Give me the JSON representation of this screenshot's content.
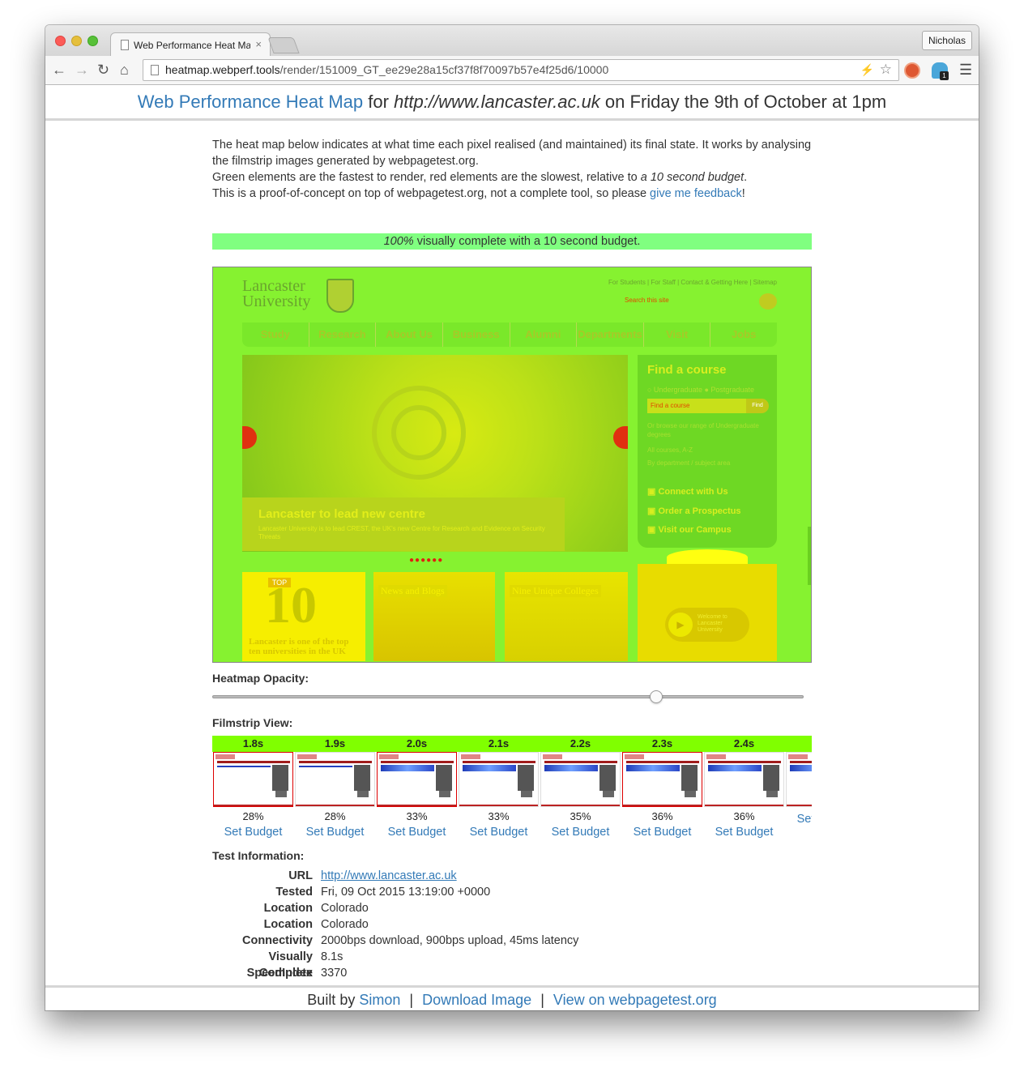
{
  "browser": {
    "tab_title": "Web Performance Heat Map",
    "tab_close": "×",
    "profile_name": "Nicholas",
    "url_host": "heatmap.webperf.tools",
    "url_path": "/render/151009_GT_ee29e28a15cf37f8f70097b57e4f25d6/10000",
    "icons": [
      "back-icon",
      "forward-icon",
      "reload-icon",
      "home-icon",
      "page-icon",
      "lightning-icon",
      "star-icon",
      "duckduckgo-icon",
      "ghostery-icon",
      "menu-icon"
    ],
    "ext_badge": "1"
  },
  "header": {
    "title_link": "Web Performance Heat Map",
    "for_text": " for ",
    "site": "http://www.lancaster.ac.uk",
    "date_text": " on Friday the 9th of October at 1pm"
  },
  "intro": {
    "line1": "The heat map below indicates at what time each pixel realised (and maintained) its final state. It works by analysing the filmstrip images generated by webpagetest.org.",
    "line2_a": "Green elements are the fastest to render, red elements are the slowest, relative to ",
    "line2_em": "a 10 second budget",
    "line2_b": ".",
    "line3_a": "This is a proof-of-concept on top of webpagetest.org, not a complete tool, so please ",
    "line3_link": "give me feedback",
    "line3_b": "!"
  },
  "complete": {
    "pct": "100%",
    "text": " visually complete with a 10 second budget."
  },
  "heatmap": {
    "logo": "Lancaster University",
    "toplinks": "For Students | For Staff | Contact & Getting Here | Sitemap",
    "search": "Search this site",
    "nav": [
      "Study",
      "Research",
      "About Us",
      "Business",
      "Alumni",
      "Departments",
      "Visit",
      "Jobs"
    ],
    "caption_title": "Lancaster to lead new centre",
    "caption_body": "Lancaster University is to lead CREST, the UK's new Centre for Research and Evidence on Security Threats",
    "dots": "●●●●●●",
    "course_title": "Find a course",
    "course_radio": "○ Undergraduate   ● Postgraduate",
    "course_input": "Find a course",
    "course_find": "Find",
    "course_txt": "Or browse our range of Undergraduate degrees",
    "course_txt2": "All courses, A-Z",
    "course_txt3": "By department / subject area",
    "link1": "Connect with Us",
    "link2": "Order a Prospectus",
    "link3": "Visit our Campus",
    "tile1_badge": "TOP",
    "tile1_big": "10",
    "tile1_txt": "Lancaster is one of the top ten universities in the UK",
    "tile2_lbl": "News and Blogs",
    "tile3_lbl": "Nine Unique Colleges",
    "video_txt": "Welcome to Lancaster University",
    "play": "▶"
  },
  "opacity": {
    "label": "Heatmap Opacity:",
    "value": 0.75
  },
  "filmstrip": {
    "label": "Filmstrip View:",
    "frames": [
      {
        "time": "1.8s",
        "pct": "28%",
        "link": "Set Budget"
      },
      {
        "time": "1.9s",
        "pct": "28%",
        "link": "Set Budget"
      },
      {
        "time": "2.0s",
        "pct": "33%",
        "link": "Set Budget"
      },
      {
        "time": "2.1s",
        "pct": "33%",
        "link": "Set Budget"
      },
      {
        "time": "2.2s",
        "pct": "35%",
        "link": "Set Budget"
      },
      {
        "time": "2.3s",
        "pct": "36%",
        "link": "Set Budget"
      },
      {
        "time": "2.4s",
        "pct": "36%",
        "link": "Set Budget"
      },
      {
        "time": "",
        "pct": "",
        "link": "Set Budget"
      }
    ]
  },
  "test_info": {
    "label": "Test Information:",
    "rows": [
      {
        "k": "URL",
        "v": "http://www.lancaster.ac.uk"
      },
      {
        "k": "Tested",
        "v": "Fri, 09 Oct 2015 13:19:00 +0000"
      },
      {
        "k": "Location",
        "v": "Colorado"
      },
      {
        "k": "Location",
        "v": "Colorado"
      },
      {
        "k": "Connectivity",
        "v": "2000bps download, 900bps upload, 45ms latency"
      },
      {
        "k": "Visually Complete",
        "v": "8.1s"
      },
      {
        "k": "SpeedIndex",
        "v": "3370"
      }
    ]
  },
  "footer": {
    "built_by": "Built by ",
    "simon": "Simon",
    "sep": "|",
    "download": "Download Image",
    "view": "View on webpagetest.org"
  },
  "colors": {
    "link": "#337ab7",
    "complete_bar": "#80ff80",
    "filmstrip_bar": "#80ff00",
    "heat_green": "#86f230",
    "heat_yellow": "#f6ee00",
    "heat_red": "#e03010"
  }
}
